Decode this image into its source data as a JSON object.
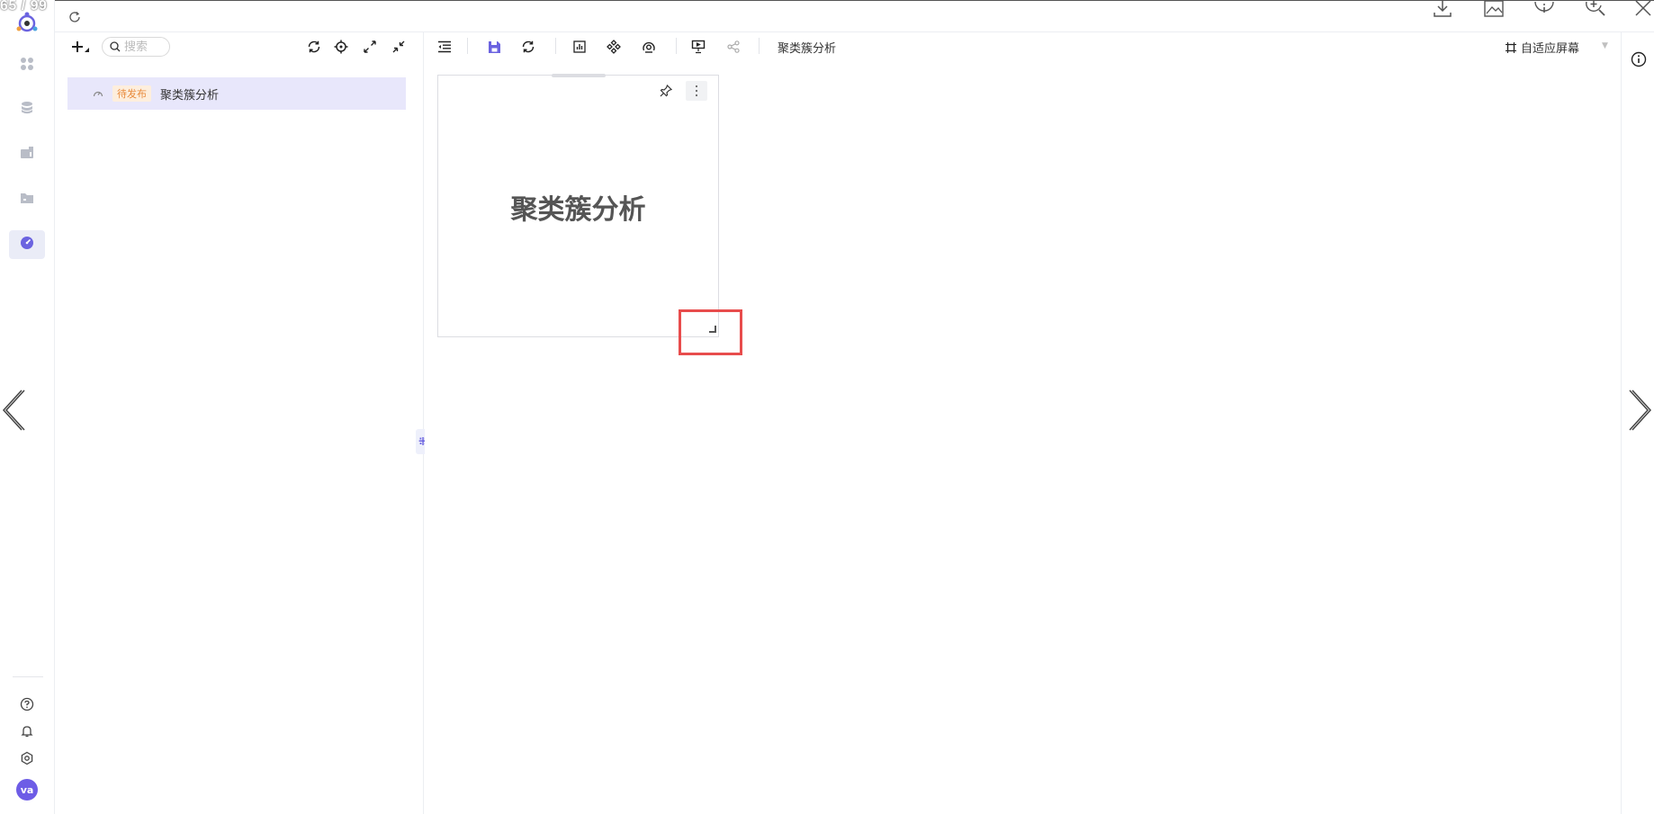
{
  "viewer": {
    "counter": "65 / 99"
  },
  "left_panel": {
    "search_placeholder": "搜索",
    "tree_items": [
      {
        "status_badge": "待发布",
        "label": "聚类簇分析"
      }
    ]
  },
  "toolbar": {
    "dashboard_title": "聚类簇分析",
    "fit_screen_label": "自适应屏幕"
  },
  "canvas": {
    "widget_title": "聚类簇分析"
  },
  "user": {
    "avatar_initials": "va"
  },
  "colors": {
    "accent": "#6b63e0",
    "badge_text": "#e88a3c",
    "badge_bg": "#fdeedd",
    "selected_row": "#e8e7fb",
    "highlight": "#e84c4c"
  },
  "icons": [
    "app-logo-icon",
    "refresh-icon",
    "apps-icon",
    "database-icon",
    "chart-box-icon",
    "folder-icon",
    "dashboard-icon",
    "help-icon",
    "bell-icon",
    "settings-icon",
    "add-icon",
    "search-icon",
    "sync-icon",
    "locate-icon",
    "expand-icon",
    "collapse-icon",
    "outdent-icon",
    "save-icon",
    "reload-icon",
    "chart-icon",
    "component-icon",
    "radar-icon",
    "present-icon",
    "share-icon",
    "fit-screen-icon",
    "info-icon",
    "pin-icon",
    "more-icon",
    "download-icon",
    "image-icon",
    "viewer-info-icon",
    "zoom-in-icon",
    "close-icon"
  ]
}
